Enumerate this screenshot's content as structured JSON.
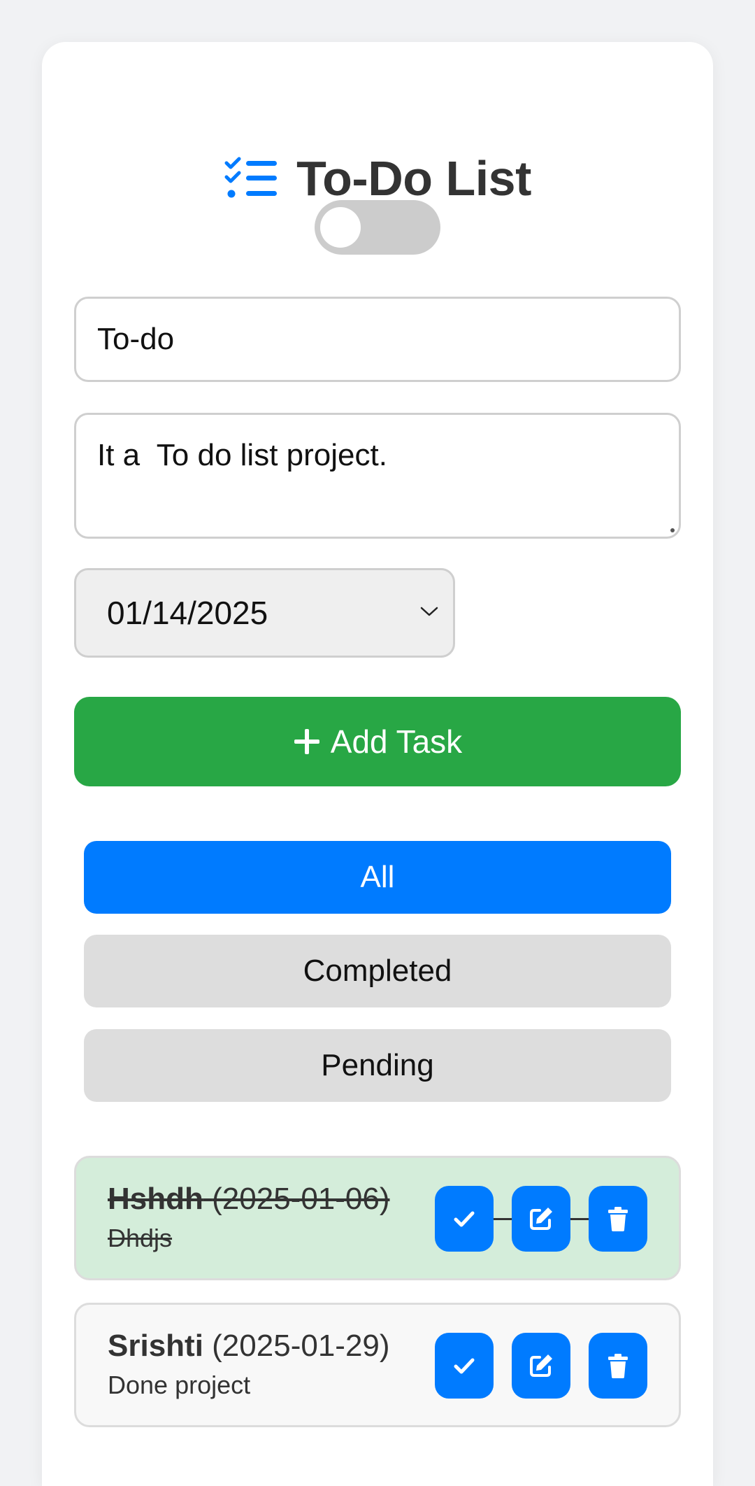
{
  "app": {
    "title": "To-Do List"
  },
  "form": {
    "title_value": "To-do",
    "description_value": "It a  To do list project.",
    "date_value": "01/14/2025",
    "add_button_label": "Add Task"
  },
  "filters": {
    "all": "All",
    "completed": "Completed",
    "pending": "Pending"
  },
  "tasks": [
    {
      "name": "Hshdh",
      "date": "(2025-01-06)",
      "description": "Dhdjs",
      "completed": true
    },
    {
      "name": "Srishti",
      "date": "(2025-01-29)",
      "description": "Done project",
      "completed": false
    }
  ],
  "colors": {
    "accent": "#007bff",
    "success": "#28a745",
    "completed_bg": "#d4edda",
    "pending_bg": "#f8f8f8"
  },
  "theme_toggle": {
    "dark_mode": false
  }
}
